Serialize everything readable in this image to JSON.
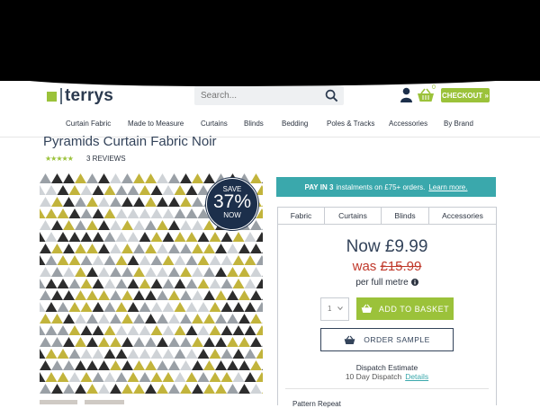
{
  "brand": {
    "name": "terrys",
    "accent": "#9bc23a",
    "navy": "#2b3a4f",
    "teal": "#3aa8ac",
    "sale_red": "#c0392b"
  },
  "header": {
    "search_placeholder": "Search...",
    "basket_count": "0",
    "checkout_label": "CHECKOUT »",
    "icons": [
      "search-icon",
      "user-icon",
      "basket-icon"
    ]
  },
  "nav": {
    "items": [
      "Curtain Fabric",
      "Made to Measure",
      "Curtains",
      "Blinds",
      "Bedding",
      "Poles & Tracks",
      "Accessories",
      "By Brand"
    ]
  },
  "product": {
    "title": "Pyramids Curtain Fabric Noir",
    "stars": "★★★★★",
    "rating": 5,
    "reviews_label": "3 REVIEWS",
    "badge": {
      "line1": "SAVE",
      "line2": "37%",
      "line3": "NOW"
    },
    "pattern_colors": [
      "#2d2d2d",
      "#c2b43c",
      "#9aa0a6",
      "#cfd3d7"
    ]
  },
  "pay": {
    "bold": "PAY IN 3",
    "text": "instalments on £75+ orders.",
    "link": "Learn more."
  },
  "tabs": [
    "Fabric",
    "Curtains",
    "Blinds",
    "Accessories"
  ],
  "pricing": {
    "now": "Now £9.99",
    "was_prefix": "was",
    "was_price": "£15.99",
    "unit": "per full metre"
  },
  "purchase": {
    "qty_value": "1",
    "add_label": "ADD TO BASKET",
    "sample_label": "ORDER SAMPLE"
  },
  "dispatch": {
    "heading": "Dispatch Estimate",
    "value": "10 Day Dispatch",
    "link": "Details"
  },
  "cut_text": "Pattern Repeat"
}
